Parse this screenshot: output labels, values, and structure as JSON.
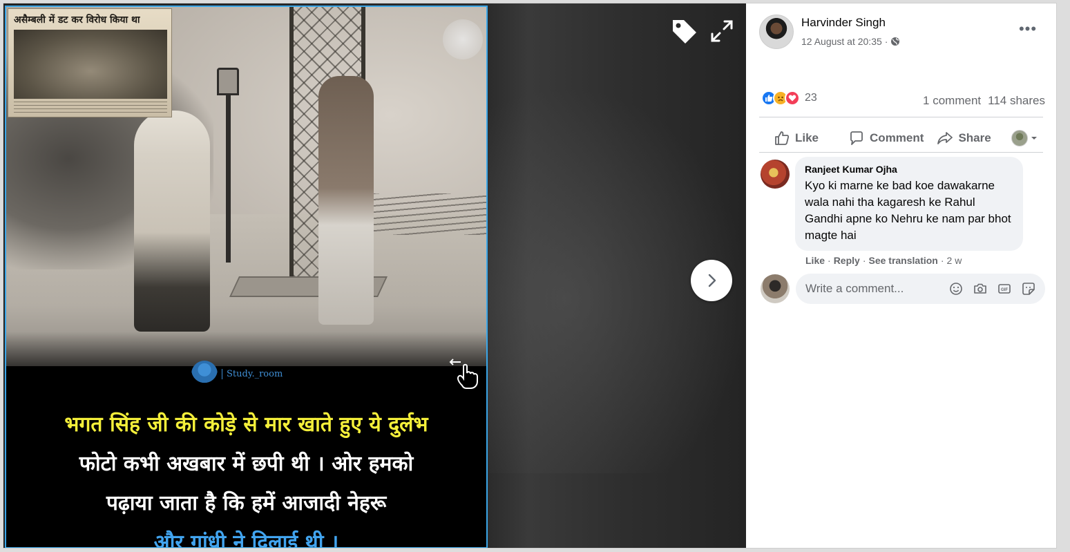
{
  "photo": {
    "clipping_headline": "असैम्बली में डट कर विरोध किया था",
    "watermark": "Study._room",
    "caption_lines": [
      "भगत सिंह जी की कोड़े से मार खाते हुए ये दुर्लभ",
      "फोटो कभी अखबार में छपी थी । ओर हमको",
      "पढ़ाया जाता है कि हमें आजादी नेहरू",
      "और गांधी ने दिलाई थी ।"
    ],
    "caption_colors": [
      "#f4ef3a",
      "#ffffff",
      "#ffffff",
      "#41a4ef"
    ],
    "accent_border": "#3aa6e8"
  },
  "viewer": {
    "tag_icon": "tag-icon",
    "expand_icon": "fullscreen-icon",
    "next_icon": "chevron-right-icon"
  },
  "post": {
    "author": "Harvinder Singh",
    "date": "12 August at 20:35",
    "separator": "·",
    "privacy_icon": "globe-icon",
    "more": "•••",
    "reaction_count": "23",
    "comments_count": "1 comment",
    "shares_count": "114 shares"
  },
  "actions": {
    "like": "Like",
    "comment": "Comment",
    "share": "Share"
  },
  "comment": {
    "author": "Ranjeet Kumar Ojha",
    "text": "Kyo ki marne ke bad koe dawakarne wala nahi tha kagaresh ke Rahul Gandhi apne ko Nehru ke nam par bhot magte hai",
    "like": "Like",
    "reply": "Reply",
    "translation": "See translation",
    "dot": "·",
    "time": "2 w"
  },
  "composer": {
    "placeholder": "Write a comment..."
  },
  "colors": {
    "brand_blue": "#1877f2",
    "secondary_text": "#65676b",
    "bubble_bg": "#f0f2f5"
  }
}
